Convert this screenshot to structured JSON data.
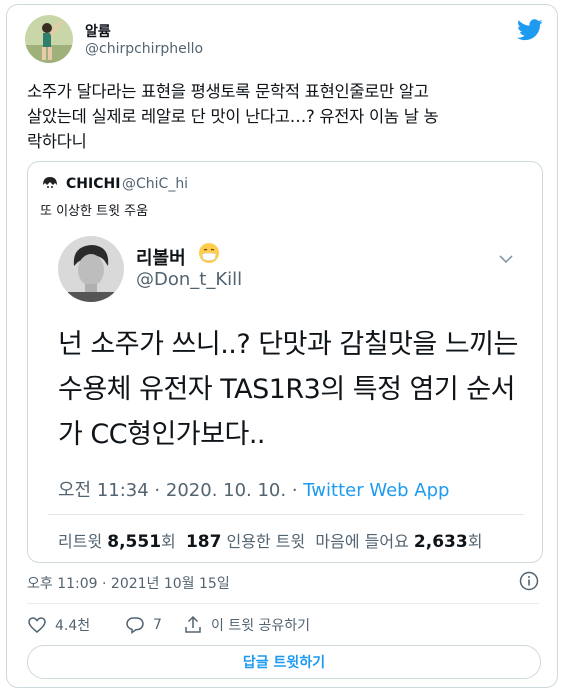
{
  "tweet": {
    "display_name": "알륨",
    "handle": "@chirpchirphello",
    "text": "소주가 달다라는 표현을 평생토록 문학적 표현인줄로만 알고\n살았는데 실제로 레알로 단 맛이 난다고…? 유전자 이놈 날 농\n락하다니",
    "timestamp": "오후 11:09 · 2021년 10월 15일"
  },
  "quote": {
    "display_name": "CHICHI",
    "handle": "@ChiC_hi",
    "text": "또 이상한 트윗 주움"
  },
  "screenshot": {
    "display_name": "리볼버",
    "handle": "@Don_t_Kill",
    "body": "넌 소주가 쓰니..? 단맛과 감칠맛을 느끼는\n수용체 유전자 TAS1R3의 특정 염기 순서\n가 CC형인가보다..",
    "meta_time": "오전 11:34 · 2020. 10. 10. · ",
    "meta_source": "Twitter Web App",
    "retweets_label": "리트윗",
    "retweets_value": "8,551",
    "retweets_unit": "회",
    "quotes_value": "187",
    "quotes_label": "인용한 트윗",
    "likes_label": "마음에 들어요",
    "likes_value": "2,633",
    "likes_unit": "회"
  },
  "actions": {
    "like_count": "4.4천",
    "reply_count": "7",
    "share_label": "이 트윗 공유하기"
  },
  "reply_button": "답글 트윗하기",
  "colors": {
    "accent": "#1d9bf0",
    "secondary_text": "#536471",
    "border": "#cfd9de"
  }
}
